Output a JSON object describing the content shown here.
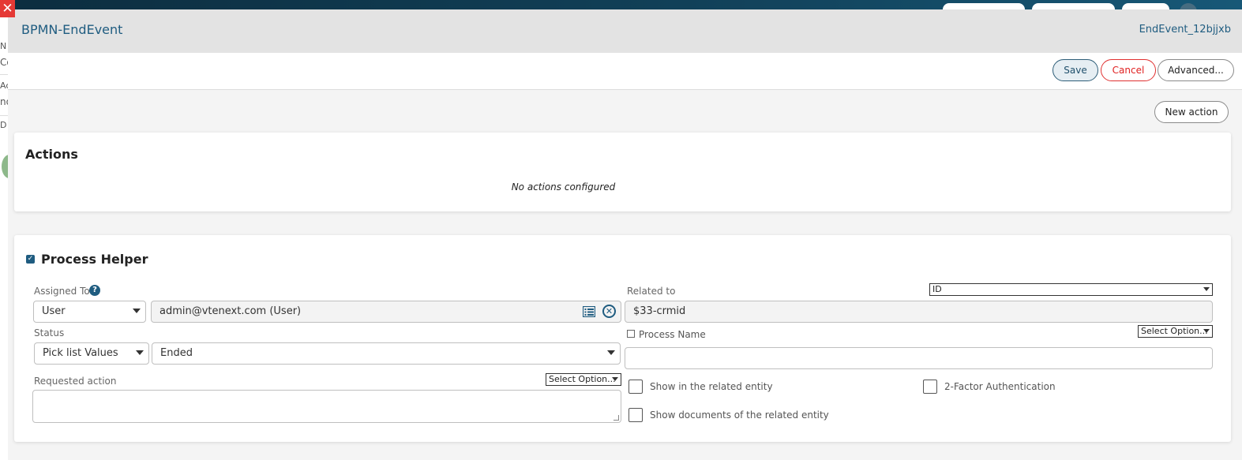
{
  "modal": {
    "title": "BPMN-EndEvent",
    "element_id": "EndEvent_12bjjxb"
  },
  "toolbar": {
    "save_label": "Save",
    "cancel_label": "Cancel",
    "advanced_label": "Advanced..."
  },
  "actions": {
    "new_action_label": "New action",
    "title": "Actions",
    "empty_message": "No actions configured"
  },
  "process_helper": {
    "enabled": true,
    "title": "Process Helper",
    "assigned_to": {
      "label": "Assigned To",
      "help_icon": "question-icon",
      "type_value": "User",
      "user_value": "admin@vtenext.com (User)"
    },
    "status": {
      "label": "Status",
      "source_value": "Pick list Values",
      "value": "Ended"
    },
    "requested_action": {
      "label": "Requested action",
      "option_placeholder": "Select Option...",
      "value": ""
    },
    "related_to": {
      "label": "Related to",
      "field_value": "ID",
      "value": "$33-crmid"
    },
    "process_name": {
      "label": "Process Name",
      "option_placeholder": "Select Option...",
      "value": ""
    },
    "show_in_related": {
      "label": "Show in the related entity",
      "checked": false
    },
    "two_factor": {
      "label": "2-Factor Authentication",
      "checked": false
    },
    "show_documents": {
      "label": "Show documents of the related entity",
      "checked": false
    }
  },
  "background": {
    "left_fragments": [
      "N",
      "Co",
      "Ac",
      "no",
      "D"
    ]
  },
  "colors": {
    "accent": "#1f5c80",
    "cancel": "#e02020",
    "header_bg": "#e3e3e3"
  }
}
